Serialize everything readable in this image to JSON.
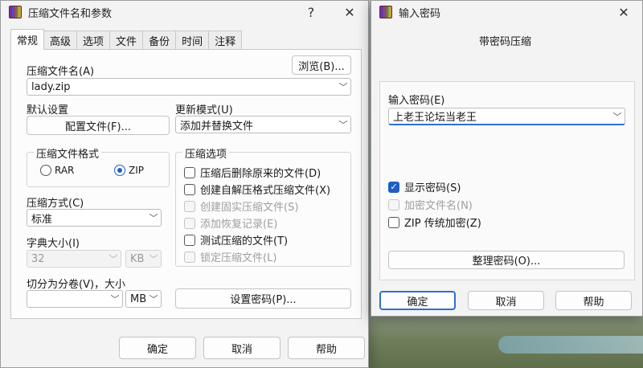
{
  "main_dialog": {
    "title": "压缩文件名和参数",
    "help_glyph": "?",
    "close_glyph": "✕",
    "tabs": [
      "常规",
      "高级",
      "选项",
      "文件",
      "备份",
      "时间",
      "注释"
    ],
    "archive_name_label": "压缩文件名(A)",
    "archive_name_value": "lady.zip",
    "browse_label": "浏览(B)...",
    "default_settings_label": "默认设置",
    "profiles_label": "配置文件(F)...",
    "update_mode_label": "更新模式(U)",
    "update_mode_value": "添加并替换文件",
    "format_group_title": "压缩文件格式",
    "format_rar": "RAR",
    "format_zip": "ZIP",
    "options_group_title": "压缩选项",
    "options": [
      {
        "label": "压缩后删除原来的文件(D)",
        "checked": false,
        "enabled": true
      },
      {
        "label": "创建自解压格式压缩文件(X)",
        "checked": false,
        "enabled": true
      },
      {
        "label": "创建固实压缩文件(S)",
        "checked": false,
        "enabled": false
      },
      {
        "label": "添加恢复记录(E)",
        "checked": false,
        "enabled": false
      },
      {
        "label": "测试压缩的文件(T)",
        "checked": false,
        "enabled": true
      },
      {
        "label": "锁定压缩文件(L)",
        "checked": false,
        "enabled": false
      }
    ],
    "method_label": "压缩方式(C)",
    "method_value": "标准",
    "dict_label": "字典大小(I)",
    "dict_value": "32",
    "dict_unit": "KB",
    "split_label": "切分为分卷(V)，大小",
    "split_value": "",
    "split_unit": "MB",
    "set_password_label": "设置密码(P)...",
    "ok_label": "确定",
    "cancel_label": "取消",
    "help_label": "帮助"
  },
  "password_dialog": {
    "title": "输入密码",
    "close_glyph": "✕",
    "subtitle": "带密码压缩",
    "password_label": "输入密码(E)",
    "password_value": "上老王论坛当老王",
    "show_password": {
      "label": "显示密码(S)",
      "checked": true
    },
    "encrypt_names": {
      "label": "加密文件名(N)",
      "checked": false,
      "enabled": false
    },
    "zip_legacy": {
      "label": "ZIP 传统加密(Z)",
      "checked": false
    },
    "organize_label": "整理密码(O)...",
    "ok_label": "确定",
    "cancel_label": "取消",
    "help_label": "帮助"
  },
  "icons": {
    "chevron": "﹀",
    "check": "✓"
  },
  "colors": {
    "accent": "#1f5fc4",
    "dialog_bg": "#f3f3f3"
  }
}
